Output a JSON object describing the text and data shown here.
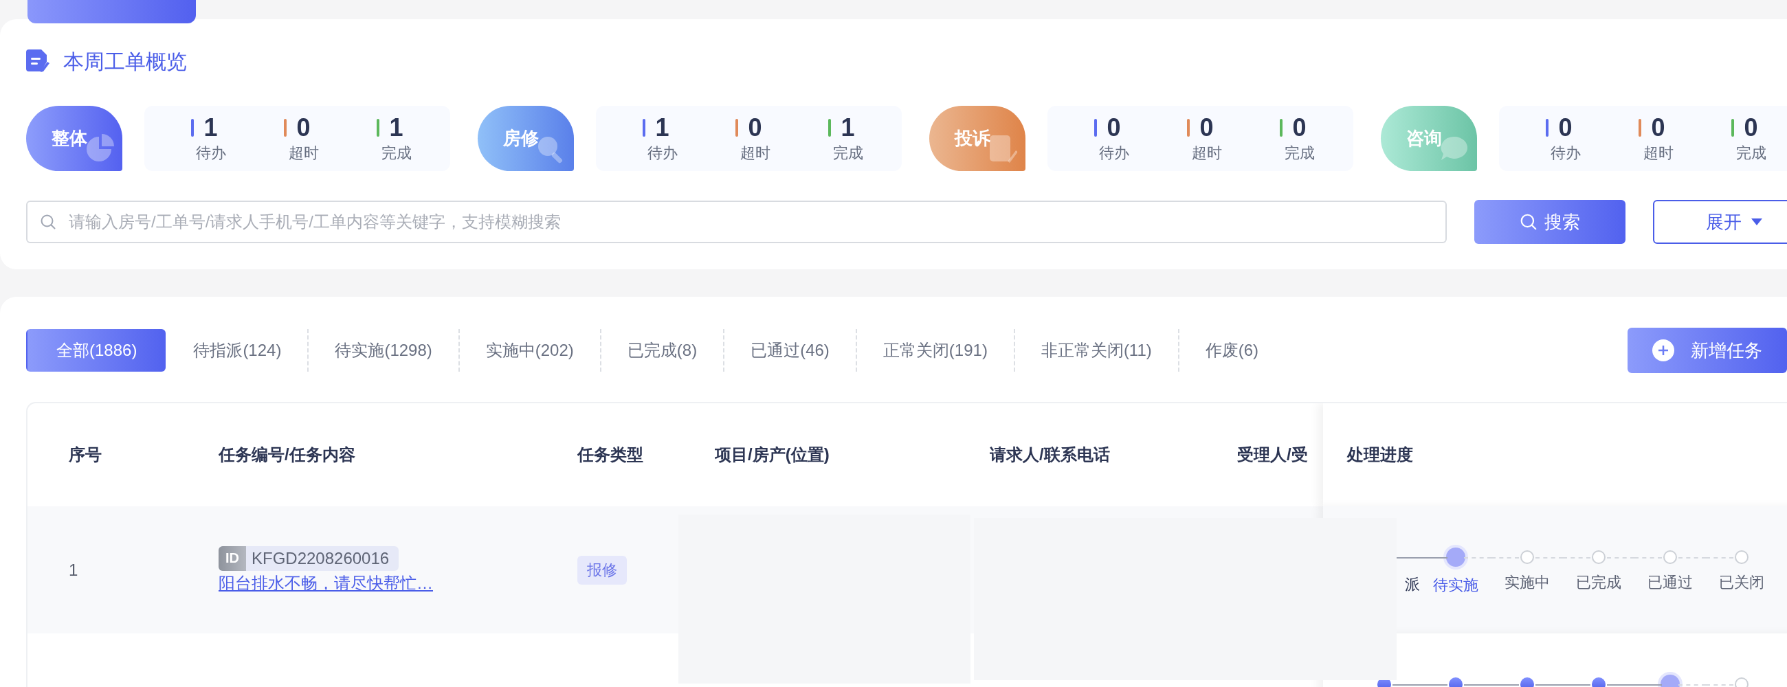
{
  "overview": {
    "title": "本周工单概览",
    "groups": [
      {
        "kind": "overall",
        "label": "整体",
        "stats": [
          {
            "kind": "todo",
            "value": "1",
            "label": "待办"
          },
          {
            "kind": "overdue",
            "value": "0",
            "label": "超时"
          },
          {
            "kind": "done",
            "value": "1",
            "label": "完成"
          }
        ]
      },
      {
        "kind": "repair",
        "label": "房修",
        "stats": [
          {
            "kind": "todo",
            "value": "1",
            "label": "待办"
          },
          {
            "kind": "overdue",
            "value": "0",
            "label": "超时"
          },
          {
            "kind": "done",
            "value": "1",
            "label": "完成"
          }
        ]
      },
      {
        "kind": "complaint",
        "label": "投诉",
        "stats": [
          {
            "kind": "todo",
            "value": "0",
            "label": "待办"
          },
          {
            "kind": "overdue",
            "value": "0",
            "label": "超时"
          },
          {
            "kind": "done",
            "value": "0",
            "label": "完成"
          }
        ]
      },
      {
        "kind": "consult",
        "label": "咨询",
        "stats": [
          {
            "kind": "todo",
            "value": "0",
            "label": "待办"
          },
          {
            "kind": "overdue",
            "value": "0",
            "label": "超时"
          },
          {
            "kind": "done",
            "value": "0",
            "label": "完成"
          }
        ]
      }
    ]
  },
  "search": {
    "placeholder": "请输入房号/工单号/请求人手机号/工单内容等关键字，支持模糊搜索",
    "button": "搜索",
    "expand": "展开"
  },
  "tabs": [
    {
      "label": "全部(1886)",
      "selected": true
    },
    {
      "label": "待指派(124)",
      "selected": false
    },
    {
      "label": "待实施(1298)",
      "selected": false
    },
    {
      "label": "实施中(202)",
      "selected": false
    },
    {
      "label": "已完成(8)",
      "selected": false
    },
    {
      "label": "已通过(46)",
      "selected": false
    },
    {
      "label": "正常关闭(191)",
      "selected": false
    },
    {
      "label": "非正常关闭(11)",
      "selected": false
    },
    {
      "label": "作废(6)",
      "selected": false
    }
  ],
  "new_button": "新增任务",
  "table": {
    "columns": [
      "序号",
      "任务编号/任务内容",
      "任务类型",
      "项目/房产(位置)",
      "请求人/联系电话",
      "受理人/受",
      "处理进度"
    ],
    "rows": [
      {
        "index": "1",
        "id_label": "ID",
        "code": "KFGD2208260016",
        "content": "阳台排水不畅，请尽快帮忙…",
        "type": "报修",
        "steps": [
          {
            "label": "派",
            "done": true,
            "current": false,
            "partial": true
          },
          {
            "label": "待实施",
            "done": false,
            "current": true,
            "partial": false
          },
          {
            "label": "实施中",
            "done": false,
            "current": false,
            "partial": false
          },
          {
            "label": "已完成",
            "done": false,
            "current": false,
            "partial": false
          },
          {
            "label": "已通过",
            "done": false,
            "current": false,
            "partial": false
          },
          {
            "label": "已关闭",
            "done": false,
            "current": false,
            "partial": false
          }
        ]
      },
      {
        "steps": [
          {
            "done": true,
            "current": false,
            "partial": false
          },
          {
            "done": true,
            "current": false,
            "partial": false
          },
          {
            "done": true,
            "current": false,
            "partial": false
          },
          {
            "done": true,
            "current": false,
            "partial": false
          },
          {
            "done": false,
            "current": true,
            "partial": false
          },
          {
            "done": false,
            "current": false,
            "partial": false
          }
        ]
      }
    ]
  }
}
